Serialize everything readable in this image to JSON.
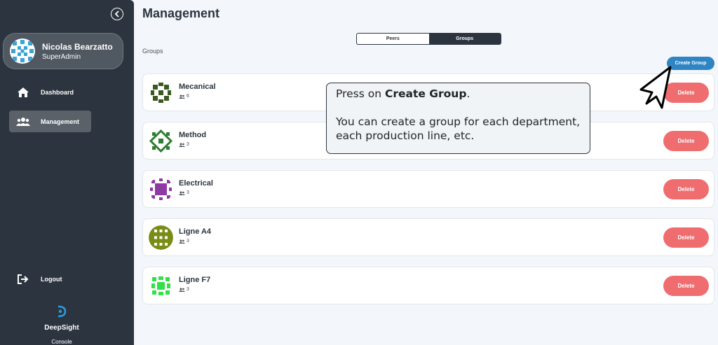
{
  "sidebar": {
    "user": {
      "name": "Nicolas Bearzatto",
      "role": "SuperAdmin"
    },
    "nav": [
      {
        "label": "Dashboard",
        "icon": "home-icon",
        "active": false
      },
      {
        "label": "Management",
        "icon": "users-icon",
        "active": true
      }
    ],
    "logout_label": "Logout",
    "brand": {
      "name": "DeepSight",
      "subtitle": "Console"
    }
  },
  "header": {
    "title": "Management"
  },
  "tabs": [
    {
      "label": "Peers",
      "selected": false
    },
    {
      "label": "Groups",
      "selected": true
    }
  ],
  "section_label": "Groups",
  "create_button_label": "Create Group",
  "delete_label": "Delete",
  "groups": [
    {
      "name": "Mecanical",
      "members": "6",
      "color": "#3b5a1f"
    },
    {
      "name": "Method",
      "members": "3",
      "color": "#2e7d32"
    },
    {
      "name": "Electrical",
      "members": "3",
      "color": "#8e3aa3"
    },
    {
      "name": "Ligne A4",
      "members": "3",
      "color": "#7a8c16"
    },
    {
      "name": "Ligne F7",
      "members": "3",
      "color": "#34e04a"
    }
  ],
  "tooltip": {
    "line1_prefix": "Press on ",
    "line1_bold": "Create Group",
    "line1_suffix": ".",
    "line2": "You can create a group for each department, each production line, etc."
  },
  "colors": {
    "sidebar_bg": "#2c353f",
    "accent": "#2f84c3",
    "danger": "#f06d6f",
    "avatar": "#3aa4d6"
  }
}
